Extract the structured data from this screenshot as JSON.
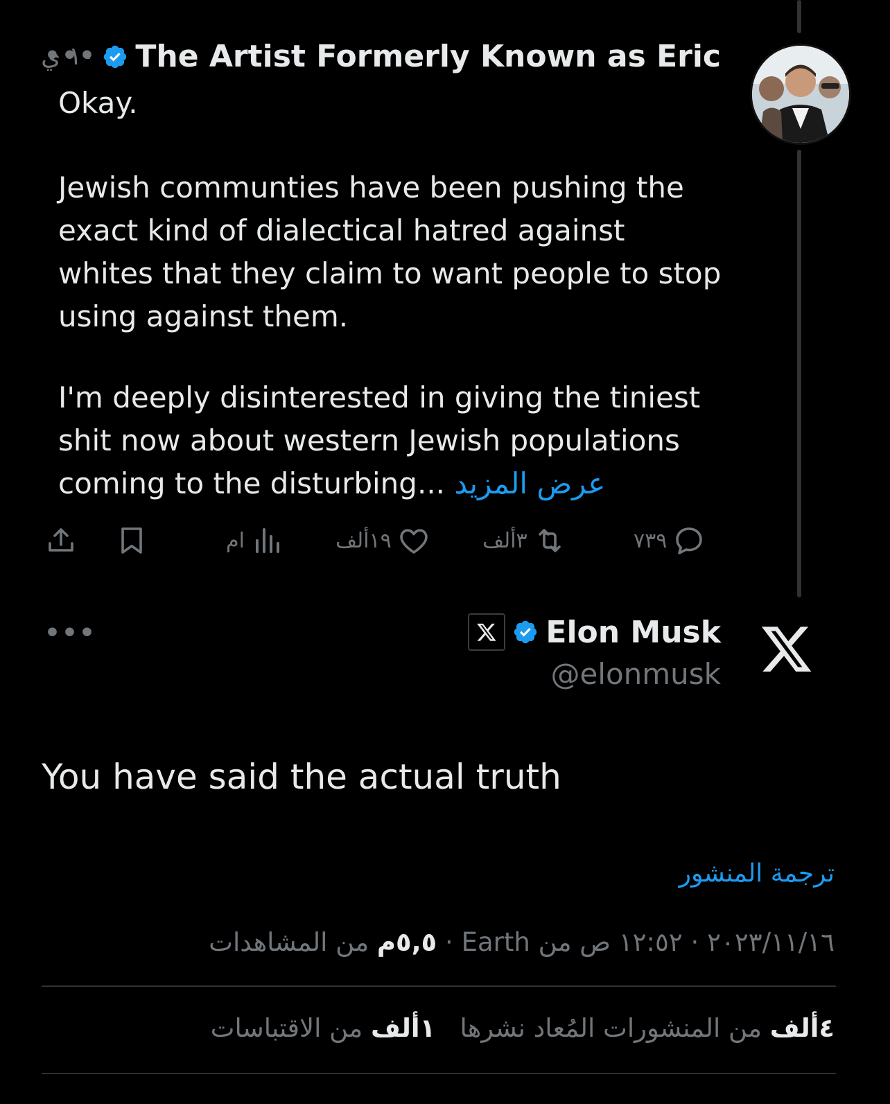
{
  "quoted_tweet": {
    "author_name": "The Artist Formerly Known as Eric",
    "timestamp": "١٠ ي",
    "more_icon": "more-dots-icon",
    "paragraphs": [
      "Okay.",
      "Jewish communties have been pushing the\nexact kind of dialectical hatred against\nwhites that they claim to want people to stop\nusing against them.",
      "I'm deeply disinterested in giving the tiniest\nshit now about western Jewish populations\ncoming to the disturbing..."
    ],
    "show_more": "عرض المزيد",
    "actions": {
      "replies": "٧٣٩",
      "reposts": "٣ألف",
      "likes": "١٩ألف",
      "views": "ام"
    }
  },
  "main_tweet": {
    "author_name": "Elon Musk",
    "handle": "@elonmusk",
    "text": "You have said the actual truth",
    "translate": "ترجمة المنشور",
    "meta": {
      "date": "٢٠٢٣/١١/١٦",
      "time": "١٢:٥٢ ص من",
      "source": "Earth",
      "views_count": "٥,٥م",
      "views_label": "من المشاهدات"
    },
    "stats": {
      "reposts_count": "٤ألف",
      "reposts_label": "من المنشورات المُعاد نشرها",
      "quotes_count": "١ألف",
      "quotes_label": "من الاقتباسات"
    }
  },
  "colors": {
    "background": "#000000",
    "text": "#e7e9ea",
    "muted": "#71767b",
    "accent": "#1d9bf0"
  }
}
